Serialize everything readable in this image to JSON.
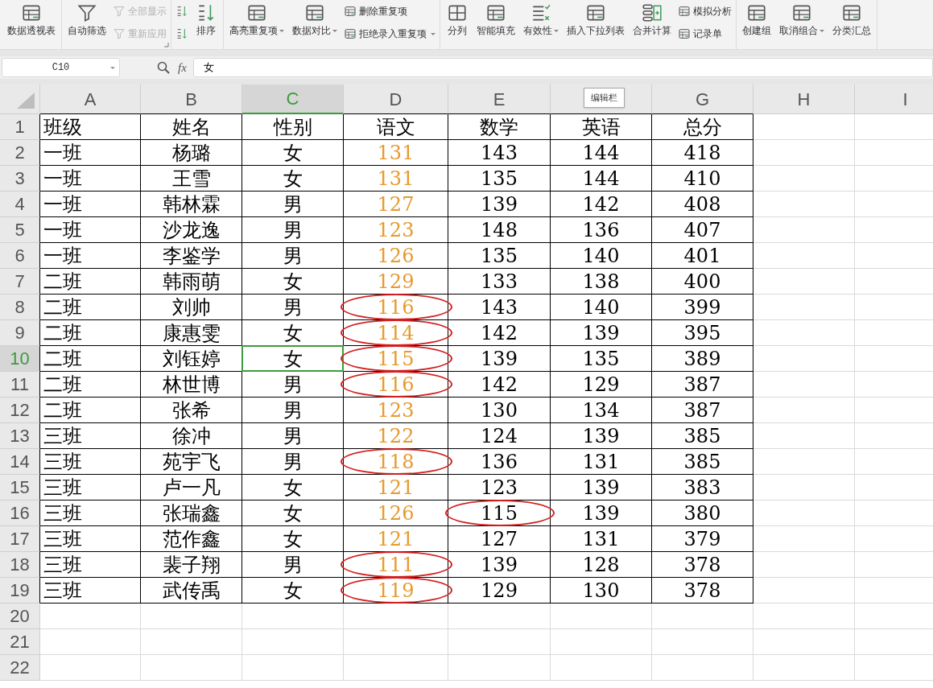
{
  "ribbon": {
    "groups": [
      {
        "launcher": false,
        "items": [
          {
            "kind": "large",
            "label": "数据透视表",
            "disabled": false,
            "dropdown": false
          }
        ]
      },
      {
        "launcher": true,
        "items": [
          {
            "kind": "large",
            "label": "自动筛选",
            "disabled": false,
            "dropdown": false
          },
          {
            "kind": "small",
            "label": "全部显示",
            "disabled": true,
            "dropdown": false
          },
          {
            "kind": "small",
            "label": "重新应用",
            "disabled": true,
            "dropdown": false
          }
        ]
      },
      {
        "launcher": false,
        "items": [
          {
            "kind": "icon",
            "disabled": false,
            "dropdown": false
          },
          {
            "kind": "icon",
            "disabled": false,
            "dropdown": false
          },
          {
            "kind": "large",
            "label": "排序",
            "disabled": false,
            "dropdown": false
          }
        ]
      },
      {
        "launcher": false,
        "items": [
          {
            "kind": "large",
            "label": "高亮重复项",
            "disabled": false,
            "dropdown": true
          },
          {
            "kind": "large",
            "label": "数据对比",
            "disabled": false,
            "dropdown": true
          },
          {
            "kind": "small",
            "label": "删除重复项",
            "disabled": false,
            "dropdown": false
          },
          {
            "kind": "small",
            "label": "拒绝录入重复项",
            "disabled": false,
            "dropdown": true
          }
        ]
      },
      {
        "launcher": false,
        "items": [
          {
            "kind": "large",
            "label": "分列",
            "disabled": false,
            "dropdown": false
          },
          {
            "kind": "large",
            "label": "智能填充",
            "disabled": false,
            "dropdown": false
          },
          {
            "kind": "large",
            "label": "有效性",
            "disabled": false,
            "dropdown": true
          },
          {
            "kind": "large",
            "label": "插入下拉列表",
            "disabled": false,
            "dropdown": false
          },
          {
            "kind": "large",
            "label": "合并计算",
            "disabled": false,
            "dropdown": false
          },
          {
            "kind": "small",
            "label": "模拟分析",
            "disabled": false,
            "dropdown": false
          },
          {
            "kind": "small",
            "label": "记录单",
            "disabled": false,
            "dropdown": false
          }
        ]
      },
      {
        "launcher": false,
        "items": [
          {
            "kind": "large",
            "label": "创建组",
            "disabled": false,
            "dropdown": false
          },
          {
            "kind": "large",
            "label": "取消组合",
            "disabled": false,
            "dropdown": true
          },
          {
            "kind": "large",
            "label": "分类汇总",
            "disabled": false,
            "dropdown": false
          }
        ]
      }
    ]
  },
  "formula_bar": {
    "name_box": "C10",
    "fx": "fx",
    "value": "女"
  },
  "sheet": {
    "columns": [
      {
        "label": "A",
        "selected": false
      },
      {
        "label": "B",
        "selected": false
      },
      {
        "label": "C",
        "selected": true
      },
      {
        "label": "D",
        "selected": false
      },
      {
        "label": "E",
        "selected": false
      },
      {
        "selected": false
      },
      {
        "label": "G",
        "selected": false
      },
      {
        "label": "H",
        "selected": false
      },
      {
        "label": "I",
        "selected": false
      }
    ],
    "tooltip": "编辑栏",
    "rows": [
      {
        "number": "1",
        "selected": false,
        "cells": [
          "班级",
          "姓名",
          "性别",
          "语文",
          "数学",
          "英语",
          "总分"
        ],
        "d_circled": false,
        "e_circled": false
      },
      {
        "number": "2",
        "selected": false,
        "cells": [
          "一班",
          "杨璐",
          "女",
          "131",
          "143",
          "144",
          "418"
        ],
        "d_circled": false,
        "e_circled": false
      },
      {
        "number": "3",
        "selected": false,
        "cells": [
          "一班",
          "王雪",
          "女",
          "131",
          "135",
          "144",
          "410"
        ],
        "d_circled": false,
        "e_circled": false
      },
      {
        "number": "4",
        "selected": false,
        "cells": [
          "一班",
          "韩林霖",
          "男",
          "127",
          "139",
          "142",
          "408"
        ],
        "d_circled": false,
        "e_circled": false
      },
      {
        "number": "5",
        "selected": false,
        "cells": [
          "一班",
          "沙龙逸",
          "男",
          "123",
          "148",
          "136",
          "407"
        ],
        "d_circled": false,
        "e_circled": false
      },
      {
        "number": "6",
        "selected": false,
        "cells": [
          "一班",
          "李鉴学",
          "男",
          "126",
          "135",
          "140",
          "401"
        ],
        "d_circled": false,
        "e_circled": false
      },
      {
        "number": "7",
        "selected": false,
        "cells": [
          "二班",
          "韩雨萌",
          "女",
          "129",
          "133",
          "138",
          "400"
        ],
        "d_circled": false,
        "e_circled": false
      },
      {
        "number": "8",
        "selected": false,
        "cells": [
          "二班",
          "刘帅",
          "男",
          "116",
          "143",
          "140",
          "399"
        ],
        "d_circled": true,
        "e_circled": false
      },
      {
        "number": "9",
        "selected": false,
        "cells": [
          "二班",
          "康惠雯",
          "女",
          "114",
          "142",
          "139",
          "395"
        ],
        "d_circled": true,
        "e_circled": false
      },
      {
        "number": "10",
        "selected": true,
        "cells": [
          "二班",
          "刘钰婷",
          "女",
          "115",
          "139",
          "135",
          "389"
        ],
        "d_circled": true,
        "e_circled": false
      },
      {
        "number": "11",
        "selected": false,
        "cells": [
          "二班",
          "林世博",
          "男",
          "116",
          "142",
          "129",
          "387"
        ],
        "d_circled": true,
        "e_circled": false
      },
      {
        "number": "12",
        "selected": false,
        "cells": [
          "二班",
          "张希",
          "男",
          "123",
          "130",
          "134",
          "387"
        ],
        "d_circled": false,
        "e_circled": false
      },
      {
        "number": "13",
        "selected": false,
        "cells": [
          "三班",
          "徐冲",
          "男",
          "122",
          "124",
          "139",
          "385"
        ],
        "d_circled": false,
        "e_circled": false
      },
      {
        "number": "14",
        "selected": false,
        "cells": [
          "三班",
          "苑宇飞",
          "男",
          "118",
          "136",
          "131",
          "385"
        ],
        "d_circled": true,
        "e_circled": false
      },
      {
        "number": "15",
        "selected": false,
        "cells": [
          "三班",
          "卢一凡",
          "女",
          "121",
          "123",
          "139",
          "383"
        ],
        "d_circled": false,
        "e_circled": false
      },
      {
        "number": "16",
        "selected": false,
        "cells": [
          "三班",
          "张瑞鑫",
          "女",
          "126",
          "115",
          "139",
          "380"
        ],
        "d_circled": false,
        "e_circled": true
      },
      {
        "number": "17",
        "selected": false,
        "cells": [
          "三班",
          "范作鑫",
          "女",
          "121",
          "127",
          "131",
          "379"
        ],
        "d_circled": false,
        "e_circled": false
      },
      {
        "number": "18",
        "selected": false,
        "cells": [
          "三班",
          "裴子翔",
          "男",
          "111",
          "139",
          "128",
          "378"
        ],
        "d_circled": true,
        "e_circled": false
      },
      {
        "number": "19",
        "selected": false,
        "cells": [
          "三班",
          "武传禹",
          "女",
          "119",
          "129",
          "130",
          "378"
        ],
        "d_circled": true,
        "e_circled": false
      },
      {
        "number": "20",
        "selected": false
      },
      {
        "number": "21",
        "selected": false
      },
      {
        "number": "22",
        "selected": false
      }
    ]
  }
}
